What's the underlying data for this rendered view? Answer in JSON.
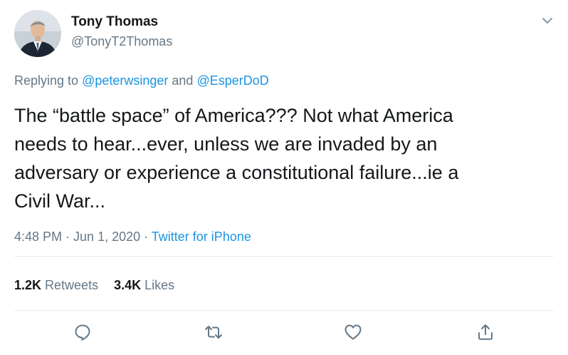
{
  "author": {
    "display_name": "Tony Thomas",
    "handle": "@TonyT2Thomas"
  },
  "reply": {
    "prefix": "Replying to ",
    "mention1": "@peterwsinger",
    "joiner": " and ",
    "mention2": "@EsperDoD"
  },
  "tweet": {
    "text": "The “battle space” of America???  Not what America\nneeds to hear...ever, unless we are invaded by an\nadversary or experience a constitutional failure...ie a\nCivil War..."
  },
  "meta": {
    "time": "4:48 PM",
    "sep1": " · ",
    "date": "Jun 1, 2020",
    "sep2": " · ",
    "source": "Twitter for iPhone"
  },
  "stats": {
    "retweets_count": "1.2K",
    "retweets_label": " Retweets",
    "likes_count": "3.4K",
    "likes_label": " Likes"
  },
  "icons": {
    "menu": "chevron-down-icon",
    "reply": "reply-icon",
    "retweet": "retweet-icon",
    "like": "heart-icon",
    "share": "share-icon"
  },
  "colors": {
    "text": "#14171a",
    "secondary": "#657786",
    "link": "#1b95e0",
    "divider": "#e6ecf0"
  }
}
